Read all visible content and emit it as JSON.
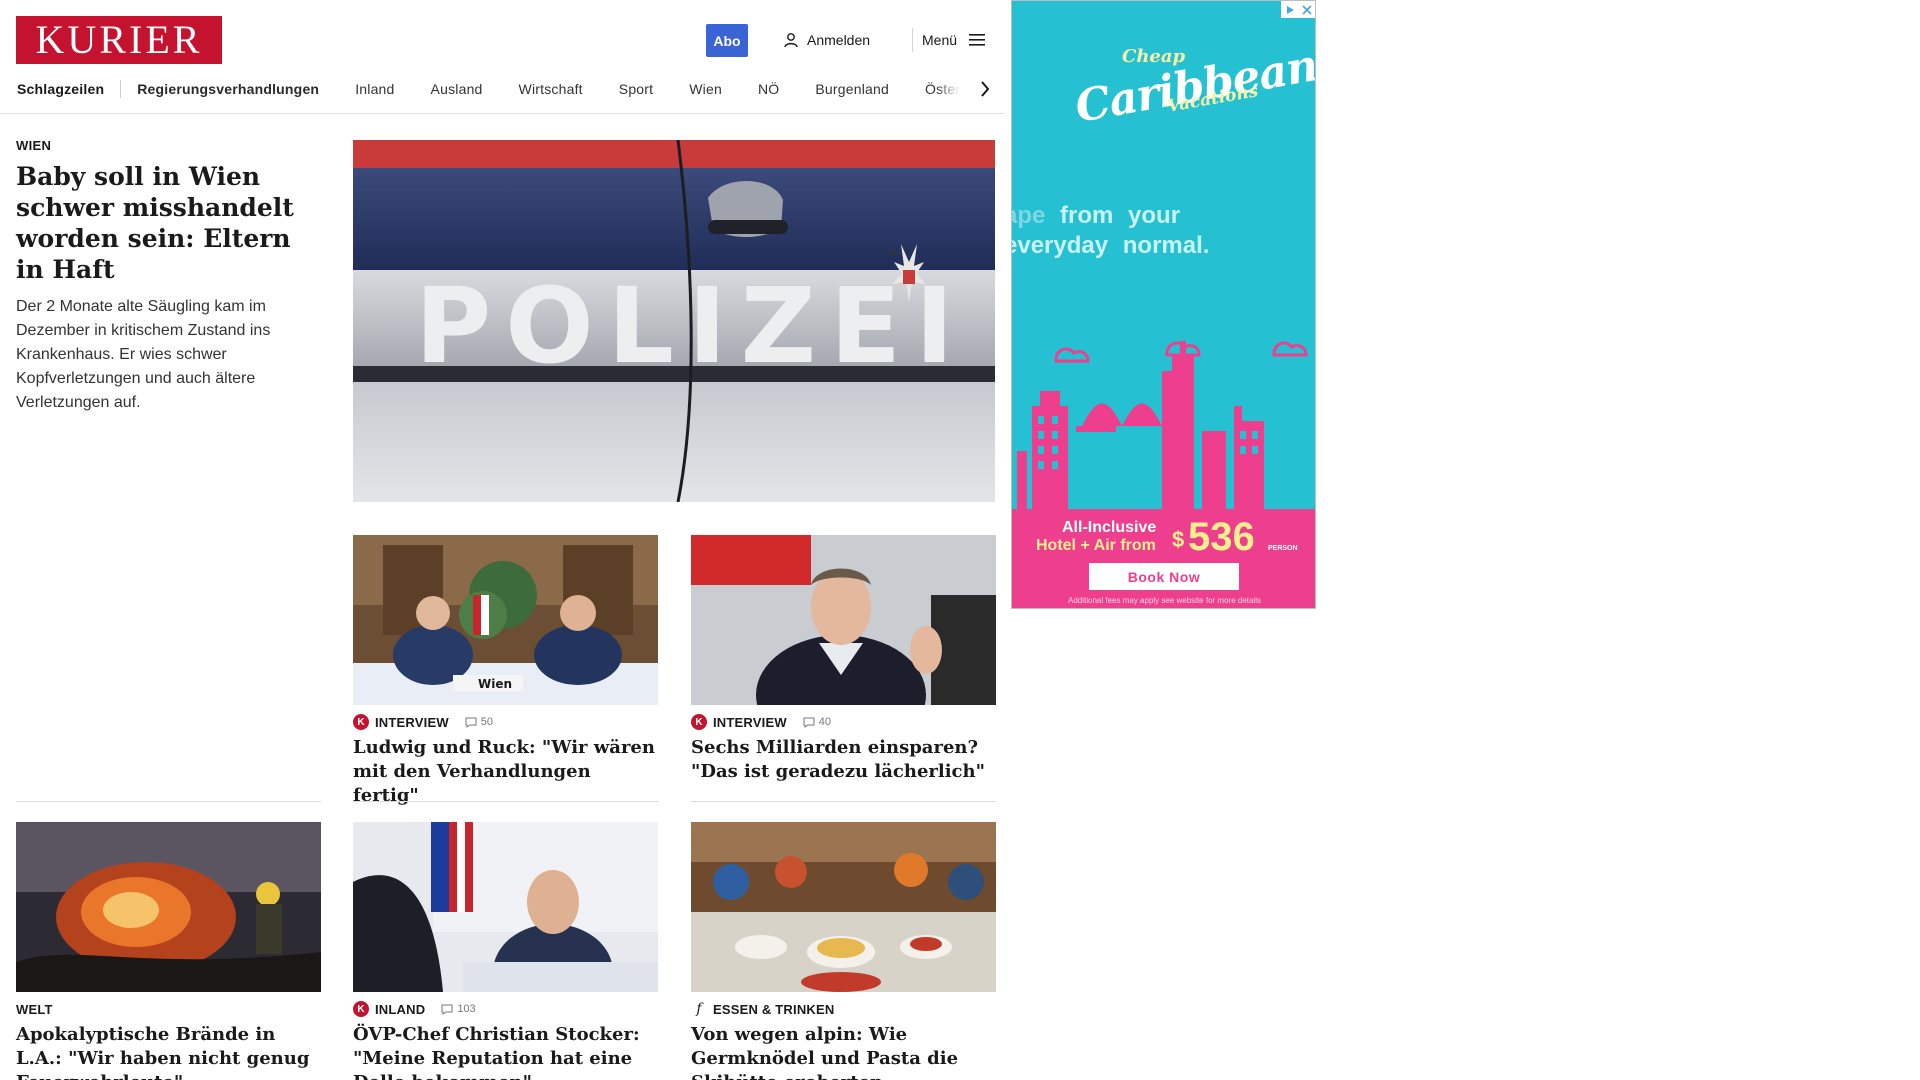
{
  "header": {
    "logo_text": "KURIER",
    "abo_label": "Abo",
    "login_label": "Anmelden",
    "menu_label": "Menü"
  },
  "nav": {
    "items": [
      "Schlagzeilen",
      "Regierungsverhandlungen",
      "Inland",
      "Ausland",
      "Wirtschaft",
      "Sport",
      "Wien",
      "NÖ",
      "Burgenland",
      "Österreich"
    ]
  },
  "lead": {
    "kicker": "WIEN",
    "title": "Baby soll in Wien schwer misshandelt worden sein: Eltern in Haft",
    "teaser": "Der 2 Monate alte Säugling kam im Dezember in kritischem Zustand ins Krankenhaus. Er wies schwer Kopfverletzungen und auch ältere Verletzungen auf.",
    "image_text": "POLIZEI"
  },
  "cards": [
    {
      "kicker": "INTERVIEW",
      "badge": "K",
      "comments": "50",
      "title": "Ludwig und Ruck: \"Wir wären mit den Verhandlungen fertig\"",
      "image_text": "Wien"
    },
    {
      "kicker": "INTERVIEW",
      "badge": "K",
      "comments": "40",
      "title": "Sechs Milliarden einsparen? \"Das ist geradezu lächerlich\""
    },
    {
      "kicker": "WELT",
      "title": "Apokalyptische Brände in L.A.: \"Wir haben nicht genug Feuerwehrleute\""
    },
    {
      "kicker": "INLAND",
      "badge": "K",
      "comments": "103",
      "title": "ÖVP-Chef Christian Stocker: \"Meine Reputation hat eine Delle bekommen\""
    },
    {
      "kicker": "ESSEN & TRINKEN",
      "badge": "f",
      "title": "Von wegen alpin: Wie Germknödel und Pasta die Skihütte eroberten"
    }
  ],
  "ad": {
    "title_line1": "Cheap",
    "title_line2": "Caribbean",
    "title_line3": "Vacations",
    "escape_line1_faint": "ape",
    "escape_line1": "from your",
    "escape_line2": "everyday normal.",
    "offer_line1": "All-Inclusive",
    "offer_line2": "Hotel + Air from",
    "price_symbol": "$",
    "price": "536",
    "price_unit": "PERSON",
    "cta": "Book Now",
    "fine_print": "Additional fees may apply see website for more details",
    "colors": {
      "background": "#26c0d3",
      "pink": "#ee3f8e",
      "yellow": "#f9ef8f"
    }
  },
  "colors": {
    "brand": "#c4122f",
    "abo": "#3a63d6"
  }
}
